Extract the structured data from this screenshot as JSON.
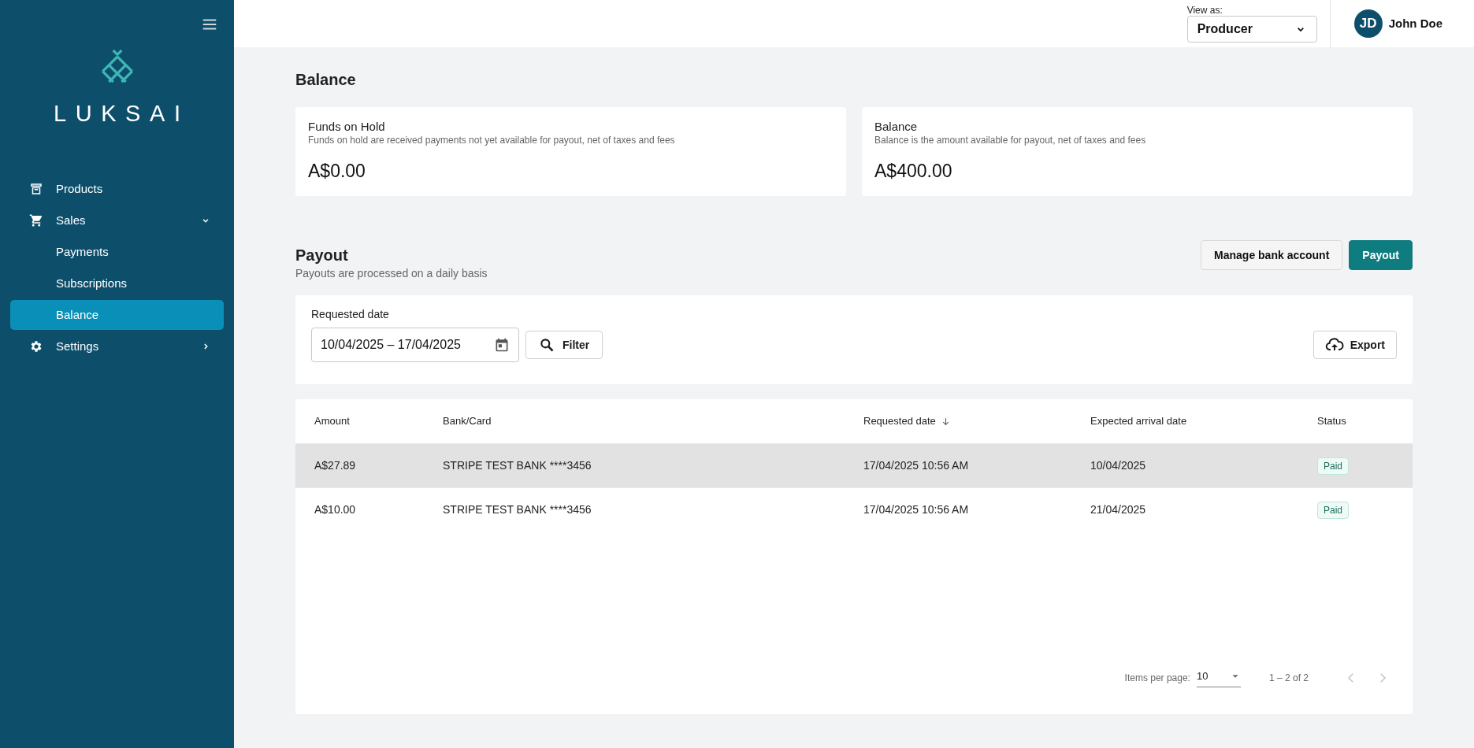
{
  "sidebar": {
    "logo": "LUKSAI",
    "items": [
      {
        "label": "Products",
        "selected": false
      },
      {
        "label": "Sales",
        "selected": false,
        "expanded": true,
        "children": [
          {
            "label": "Payments",
            "selected": false
          },
          {
            "label": "Subscriptions",
            "selected": false
          },
          {
            "label": "Balance",
            "selected": true
          }
        ]
      },
      {
        "label": "Settings",
        "selected": false,
        "expanded": false
      }
    ]
  },
  "header": {
    "view_as_label": "View as:",
    "view_as_value": "Producer",
    "avatar_initials": "JD",
    "user_name": "John Doe"
  },
  "balance": {
    "title": "Balance",
    "cards": [
      {
        "title": "Funds on Hold",
        "description": "Funds on hold are received payments not yet available for payout, net of taxes and fees",
        "amount": "A$0.00"
      },
      {
        "title": "Balance",
        "description": "Balance is the amount available for payout, net of taxes and fees",
        "amount": "A$400.00"
      }
    ]
  },
  "payout": {
    "title": "Payout",
    "subtitle": "Payouts are processed on a daily basis",
    "buttons": [
      {
        "label": "Manage bank account",
        "kind": "secondary"
      },
      {
        "label": "Payout",
        "kind": "primary"
      }
    ],
    "filter": {
      "label": "Requested date",
      "value": "10/04/2025 – 17/04/2025",
      "filter_button": "Filter",
      "export_button": "Export"
    },
    "table": {
      "columns": [
        {
          "label": "Amount",
          "sorted": false
        },
        {
          "label": "Bank/Card",
          "sorted": false
        },
        {
          "label": "Requested date",
          "sorted": true
        },
        {
          "label": "Expected arrival date",
          "sorted": false
        },
        {
          "label": "Status",
          "sorted": false
        }
      ],
      "rows": [
        {
          "selected": true,
          "cells": [
            "A$27.89",
            "STRIPE TEST BANK ****3456",
            "17/04/2025 10:56 AM",
            "10/04/2025",
            "Paid"
          ]
        },
        {
          "selected": false,
          "cells": [
            "A$10.00",
            "STRIPE TEST BANK ****3456",
            "17/04/2025 10:56 AM",
            "21/04/2025",
            "Paid"
          ]
        }
      ]
    },
    "pagination": {
      "items_per_page_label": "Items per page:",
      "items_per_page": "10",
      "range": "1 – 2 of 2",
      "prev_disabled": true,
      "next_disabled": true
    }
  }
}
